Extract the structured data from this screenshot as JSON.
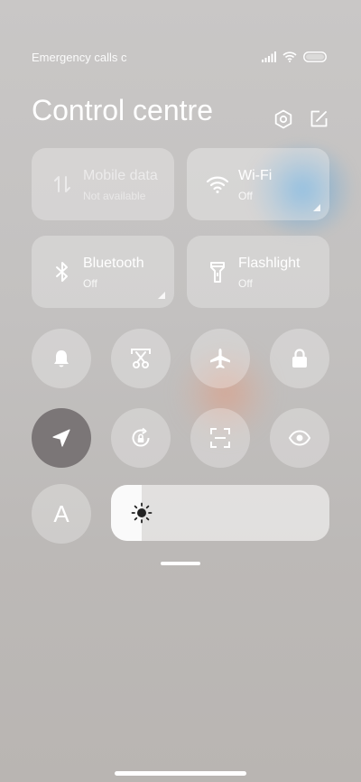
{
  "status_bar": {
    "left_text": "Emergency calls c",
    "icons": [
      "signal-icon",
      "wifi-icon",
      "battery-icon"
    ]
  },
  "header": {
    "title": "Control centre",
    "icons": [
      "settings-icon",
      "edit-icon"
    ]
  },
  "tiles": [
    {
      "id": "mobile-data",
      "title": "Mobile data",
      "subtitle": "Not available",
      "icon": "mobile-data-icon",
      "enabled": false
    },
    {
      "id": "wifi",
      "title": "Wi-Fi",
      "subtitle": "Off",
      "icon": "wifi-icon",
      "enabled": true
    },
    {
      "id": "bluetooth",
      "title": "Bluetooth",
      "subtitle": "Off",
      "icon": "bluetooth-icon",
      "enabled": true
    },
    {
      "id": "flashlight",
      "title": "Flashlight",
      "subtitle": "Off",
      "icon": "flashlight-icon",
      "enabled": true
    }
  ],
  "toggles": [
    {
      "id": "ring",
      "icon": "bell-icon",
      "active": false
    },
    {
      "id": "screenshot",
      "icon": "scissors-screenshot-icon",
      "active": false
    },
    {
      "id": "airplane",
      "icon": "airplane-icon",
      "active": false
    },
    {
      "id": "lock",
      "icon": "lock-icon",
      "active": false
    },
    {
      "id": "location",
      "icon": "location-arrow-icon",
      "active": true
    },
    {
      "id": "rotation-lock",
      "icon": "rotation-lock-icon",
      "active": false
    },
    {
      "id": "scanner",
      "icon": "scan-icon",
      "active": false
    },
    {
      "id": "reading-mode",
      "icon": "eye-icon",
      "active": false
    }
  ],
  "auto_brightness": {
    "label": "A"
  },
  "brightness": {
    "level_fraction": 0.14,
    "icon": "sun-icon"
  },
  "colors": {
    "active_toggle": "#7b7677",
    "accent_blue": "#56a0d6"
  }
}
